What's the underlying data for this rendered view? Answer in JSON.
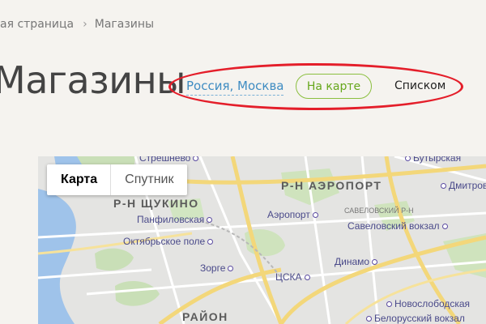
{
  "breadcrumb": {
    "home": "ая страница",
    "separator": "›",
    "current": "Магазины"
  },
  "page": {
    "title": "Магазины"
  },
  "controls": {
    "region": "Россия, Москва",
    "view_map": "На карте",
    "view_list": "Списком"
  },
  "colors": {
    "accent_link": "#3f8cc2",
    "toggle_green": "#66a71c",
    "annotation_red": "#e41e2a",
    "background": "#f5f3ef"
  },
  "map": {
    "type_buttons": {
      "map": "Карта",
      "satellite": "Спутник"
    },
    "districts": {
      "shchukino": "Р-Н ЩУКИНО",
      "aeroport": "Р-Н АЭРОПОРТ",
      "raion": "РАЙОН"
    },
    "metro": {
      "streshnevo": "Стрешнево",
      "butyrskaya": "Бутырская",
      "dmitrovskaya": "Дмитров",
      "panfilovskaya": "Панфиловская",
      "aeroport": "Аэропорт",
      "oktyabrskoe_pole": "Октябрьское поле",
      "savelovsky_station": "Савеловский вокзал",
      "zorge": "Зорге",
      "dinamo": "Динамо",
      "cska": "ЦСКА",
      "novoslobodskaya": "Новослободская",
      "belorussky_station": "Белорусский вокзал"
    },
    "streets": {
      "savelovsky": "САВЕЛОВСКИЙ Р-Н"
    }
  }
}
